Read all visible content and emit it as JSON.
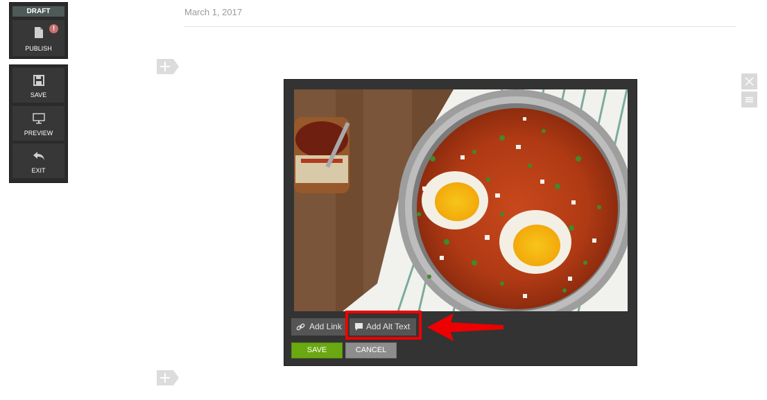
{
  "toolbar": {
    "draft_label": "DRAFT",
    "publish_label": "PUBLISH",
    "alert_symbol": "!",
    "save_label": "SAVE",
    "preview_label": "PREVIEW",
    "exit_label": "EXIT"
  },
  "post": {
    "date": "March 1, 2017"
  },
  "image_editor": {
    "image_icon": "photo-shakshuka",
    "add_link_label": "Add Link",
    "add_alt_text_label": "Add Alt Text",
    "save_label": "SAVE",
    "cancel_label": "CANCEL"
  },
  "icons": [
    "file-icon",
    "floppy-disk-icon",
    "monitor-icon",
    "undo-arrow-icon",
    "link-icon",
    "speech-bubble-icon",
    "plus-icon",
    "close-icon",
    "menu-icon"
  ],
  "colors": {
    "save_green": "#69a811",
    "highlight_red": "#ee0000",
    "panel_dark": "#2b2b2b"
  }
}
